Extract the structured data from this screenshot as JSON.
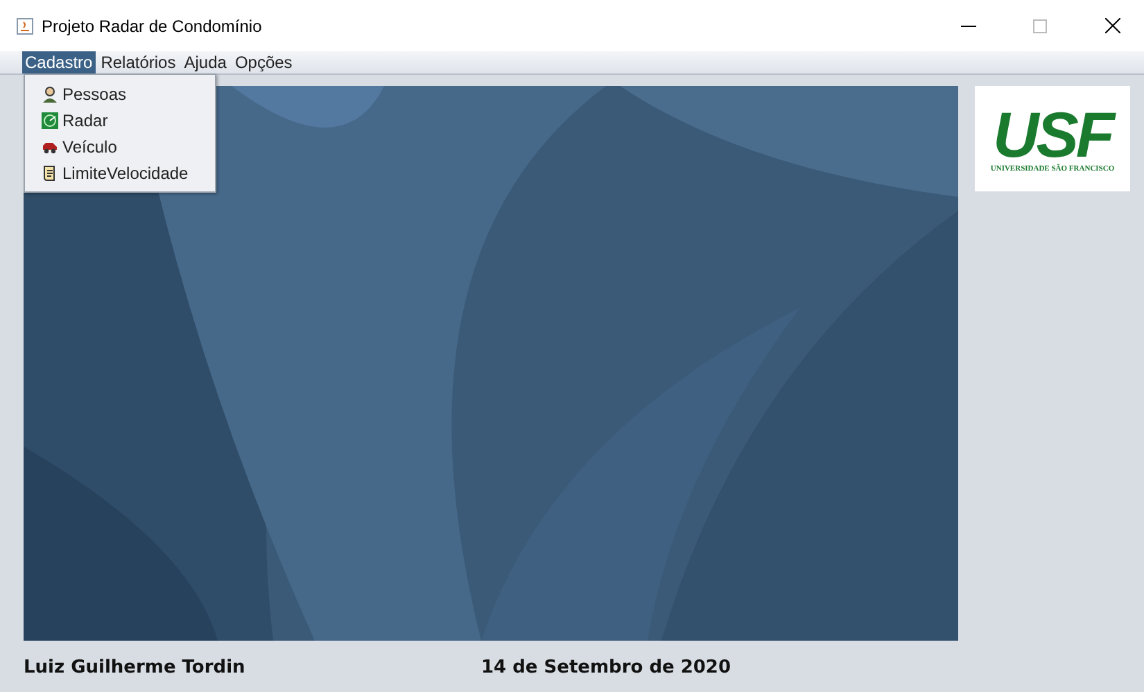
{
  "window": {
    "title": "Projeto Radar de Condomínio"
  },
  "menu_bar": [
    {
      "label": "Cadastro",
      "selected": true
    },
    {
      "label": "Relatórios",
      "selected": false
    },
    {
      "label": "Ajuda",
      "selected": false
    },
    {
      "label": "Opções",
      "selected": false
    }
  ],
  "dropdown": {
    "items": [
      {
        "label": "Pessoas",
        "kind": "person"
      },
      {
        "label": "Radar",
        "kind": "radar"
      },
      {
        "label": "Veículo",
        "kind": "car"
      },
      {
        "label": "LimiteVelocidade",
        "kind": "scroll"
      }
    ]
  },
  "logo": {
    "mark": "USF",
    "subtitle": "UNIVERSIDADE SÃO FRANCISCO"
  },
  "footer": {
    "author": "Luiz Guilherme Tordin",
    "date": "14 de Setembro de 2020"
  }
}
